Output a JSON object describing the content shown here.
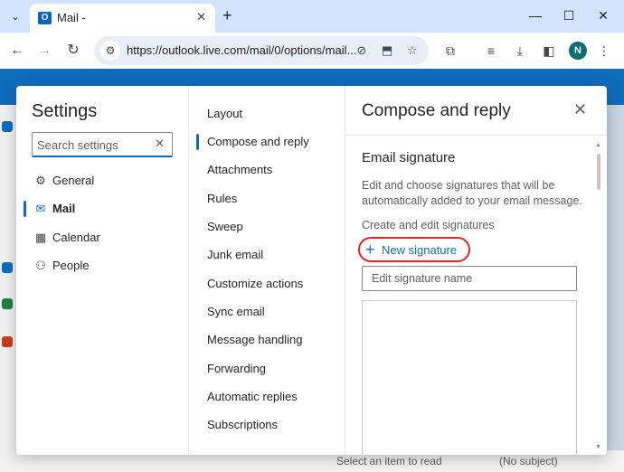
{
  "browser": {
    "tab_title": "Mail -",
    "favicon_letter": "O",
    "url": "https://outlook.live.com/mail/0/options/mail...",
    "profile_initial": "N"
  },
  "settings": {
    "title": "Settings",
    "search_placeholder": "Search settings",
    "categories": [
      {
        "label": "General",
        "icon": "gear-icon"
      },
      {
        "label": "Mail",
        "icon": "mail-icon"
      },
      {
        "label": "Calendar",
        "icon": "calendar-icon"
      },
      {
        "label": "People",
        "icon": "people-icon"
      }
    ],
    "active_category": "Mail",
    "mail_sections": [
      "Layout",
      "Compose and reply",
      "Attachments",
      "Rules",
      "Sweep",
      "Junk email",
      "Customize actions",
      "Sync email",
      "Message handling",
      "Forwarding",
      "Automatic replies",
      "Subscriptions"
    ],
    "active_section": "Compose and reply"
  },
  "pane": {
    "title": "Compose and reply",
    "section_title": "Email signature",
    "description": "Edit and choose signatures that will be automatically added to your email message.",
    "create_label": "Create and edit signatures",
    "new_signature_label": "New signature",
    "signature_name_placeholder": "Edit signature name"
  },
  "background": {
    "reading_hint": "Select an item to read",
    "draft_label": "(No subject)"
  },
  "colors": {
    "accent": "#0f6cbd",
    "highlight_ring": "#e0262a",
    "tabstrip": "#d3e3fd"
  }
}
